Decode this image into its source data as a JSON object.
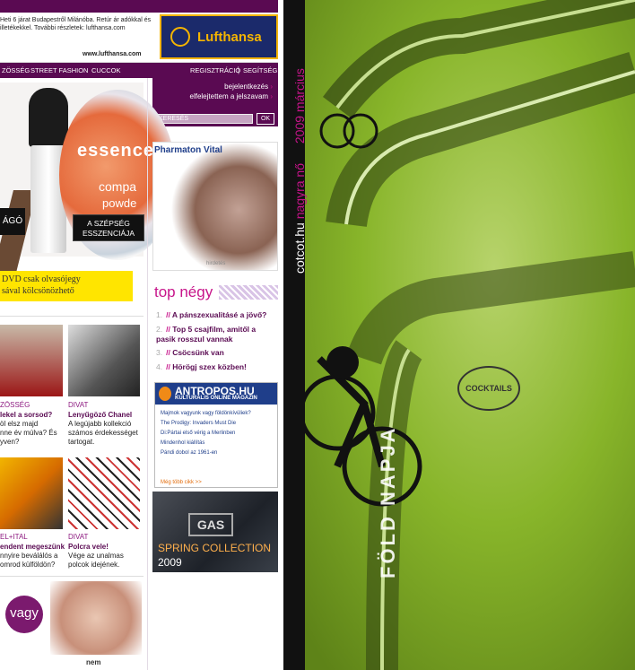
{
  "ad_top": {
    "text": "Heti 6 járat Budapestről Milánóba. Retúr ár adókkal és illetékekkel. További részletek: lufthansa.com",
    "url": "www.lufthansa.com",
    "brand": "Lufthansa"
  },
  "nav": {
    "items": [
      "ZÖSSÉG",
      "STREET FASHION",
      "CUCCOK"
    ],
    "register": "REGISZTRÁCIÓ",
    "help": "SEGÍTSÉG",
    "separator": "|"
  },
  "login": {
    "login_link": "bejelentkezés",
    "forgot_link": "elfelejtettem a jelszavam",
    "search_placeholder": "KERESÉS",
    "ok_label": "OK"
  },
  "essence_ad": {
    "left_label": "ÁGÓ",
    "right_label_line1": "A SZÉPSÉG",
    "right_label_line2": "ESSZENCIÁJA",
    "brand": "essence",
    "compact_line1": "compa",
    "compact_line2": "powde"
  },
  "dvd_banner": {
    "line1": "DVD csak olvasójegy",
    "line2": "sával kölcsönözhető"
  },
  "tiles": [
    {
      "category": "ZÖSSÉG",
      "title": "lekel a sorsod?",
      "text": "öl elsz majd\nnne év múlva? És\nyven?"
    },
    {
      "category": "DIVAT",
      "title": "Lenyűgöző Chanel",
      "text": "A legújabb kollekció\nszámos érdekességet\ntartogat."
    },
    {
      "category": "EL+ITAL",
      "title": "endent megeszünk",
      "text": "nnyire beválálós a\nomrod külföldön?"
    },
    {
      "category": "DIVAT",
      "title": "Polcra vele!",
      "text": "Vége az unalmas\npolcok idejének."
    }
  ],
  "bottom_labels": {
    "vagy": "vagy",
    "nem": "nem"
  },
  "pharmaton": {
    "label": "Pharmaton Vital",
    "caption": "hirdetés"
  },
  "top_negy": {
    "title": "top négy",
    "items": [
      {
        "num": "1.",
        "text": "A pánszexualitásé a jövő?"
      },
      {
        "num": "2.",
        "text": "Top 5 csajfilm, amitől a pasik rosszul vannak"
      },
      {
        "num": "3.",
        "text": "Csöcsünk van"
      },
      {
        "num": "4.",
        "text": "Hörögj szex közben!"
      }
    ]
  },
  "antropos": {
    "title": "ANTROPOS.HU",
    "subtitle": "KULTURÁLIS ONLINE MAGAZIN",
    "links": [
      "Majmok vagyunk vagy földönkívüliek?",
      "The Prodigy: Invaders Must Die",
      "Di:Pártai első vérig a Merlinben",
      "Mindenhol kiállítás",
      "Pándi dobol az 1961-en"
    ],
    "more": "Még több cikk >>"
  },
  "gas_ad": {
    "brand": "GAS",
    "line1": "SPRING COLLECTION",
    "line2": "2009"
  },
  "cover": {
    "spine_site": "cotcot.hu",
    "spine_name": "nagyra nő",
    "spine_date": "2009 március",
    "headline": "FÖLD NAPJA",
    "badge": "COCKTAILS"
  },
  "colors": {
    "purple": "#5a0a52",
    "magenta": "#c7148a",
    "green": "#88b52a"
  }
}
